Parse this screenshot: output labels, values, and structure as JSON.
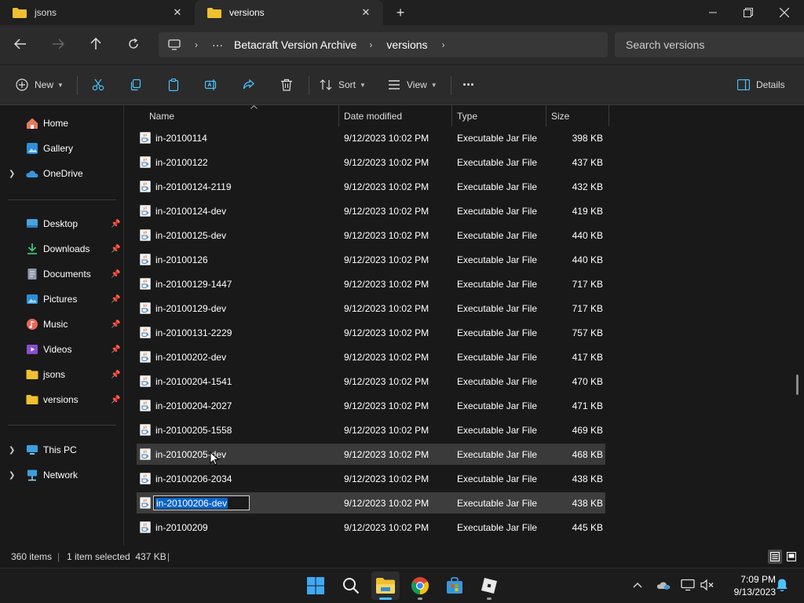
{
  "tabs": [
    {
      "title": "jsons"
    },
    {
      "title": "versions"
    }
  ],
  "address": {
    "crumbs": [
      "Betacraft Version Archive",
      "versions"
    ],
    "ellipsis": "···",
    "search_placeholder": "Search versions"
  },
  "toolbar": {
    "new_label": "New",
    "sort_label": "Sort",
    "view_label": "View",
    "more_label": "···",
    "details_label": "Details"
  },
  "sidebar": {
    "quick": [
      {
        "label": "Home",
        "icon": "home-icon"
      },
      {
        "label": "Gallery",
        "icon": "gallery-icon"
      },
      {
        "label": "OneDrive",
        "icon": "cloud-icon"
      }
    ],
    "pinned": [
      {
        "label": "Desktop",
        "icon": "desktop-icon"
      },
      {
        "label": "Downloads",
        "icon": "download-icon"
      },
      {
        "label": "Documents",
        "icon": "documents-icon"
      },
      {
        "label": "Pictures",
        "icon": "pictures-icon"
      },
      {
        "label": "Music",
        "icon": "music-icon"
      },
      {
        "label": "Videos",
        "icon": "videos-icon"
      },
      {
        "label": "jsons",
        "icon": "folder-icon"
      },
      {
        "label": "versions",
        "icon": "folder-icon"
      }
    ],
    "devices": [
      {
        "label": "This PC",
        "icon": "pc-icon"
      },
      {
        "label": "Network",
        "icon": "network-icon"
      }
    ]
  },
  "columns": {
    "name": "Name",
    "date": "Date modified",
    "type": "Type",
    "size": "Size"
  },
  "files": [
    {
      "name": "in-20100114",
      "date": "9/12/2023 10:02 PM",
      "type": "Executable Jar File",
      "size": "398 KB"
    },
    {
      "name": "in-20100122",
      "date": "9/12/2023 10:02 PM",
      "type": "Executable Jar File",
      "size": "437 KB"
    },
    {
      "name": "in-20100124-2119",
      "date": "9/12/2023 10:02 PM",
      "type": "Executable Jar File",
      "size": "432 KB"
    },
    {
      "name": "in-20100124-dev",
      "date": "9/12/2023 10:02 PM",
      "type": "Executable Jar File",
      "size": "419 KB"
    },
    {
      "name": "in-20100125-dev",
      "date": "9/12/2023 10:02 PM",
      "type": "Executable Jar File",
      "size": "440 KB"
    },
    {
      "name": "in-20100126",
      "date": "9/12/2023 10:02 PM",
      "type": "Executable Jar File",
      "size": "440 KB"
    },
    {
      "name": "in-20100129-1447",
      "date": "9/12/2023 10:02 PM",
      "type": "Executable Jar File",
      "size": "717 KB"
    },
    {
      "name": "in-20100129-dev",
      "date": "9/12/2023 10:02 PM",
      "type": "Executable Jar File",
      "size": "717 KB"
    },
    {
      "name": "in-20100131-2229",
      "date": "9/12/2023 10:02 PM",
      "type": "Executable Jar File",
      "size": "757 KB"
    },
    {
      "name": "in-20100202-dev",
      "date": "9/12/2023 10:02 PM",
      "type": "Executable Jar File",
      "size": "417 KB"
    },
    {
      "name": "in-20100204-1541",
      "date": "9/12/2023 10:02 PM",
      "type": "Executable Jar File",
      "size": "470 KB"
    },
    {
      "name": "in-20100204-2027",
      "date": "9/12/2023 10:02 PM",
      "type": "Executable Jar File",
      "size": "471 KB"
    },
    {
      "name": "in-20100205-1558",
      "date": "9/12/2023 10:02 PM",
      "type": "Executable Jar File",
      "size": "469 KB"
    },
    {
      "name": "in-20100205-dev",
      "date": "9/12/2023 10:02 PM",
      "type": "Executable Jar File",
      "size": "468 KB"
    },
    {
      "name": "in-20100206-2034",
      "date": "9/12/2023 10:02 PM",
      "type": "Executable Jar File",
      "size": "438 KB"
    },
    {
      "name": "in-20100206-dev",
      "date": "9/12/2023 10:02 PM",
      "type": "Executable Jar File",
      "size": "438 KB"
    },
    {
      "name": "in-20100209",
      "date": "9/12/2023 10:02 PM",
      "type": "Executable Jar File",
      "size": "445 KB"
    }
  ],
  "status": {
    "count": "360 items",
    "selection": "1 item selected  437 KB"
  },
  "clock": {
    "time": "7:09 PM",
    "date": "9/13/2023"
  },
  "colors": {
    "folder": "#f0c030",
    "accent": "#4cc2ff",
    "selection_highlight": "#0a64c8"
  }
}
